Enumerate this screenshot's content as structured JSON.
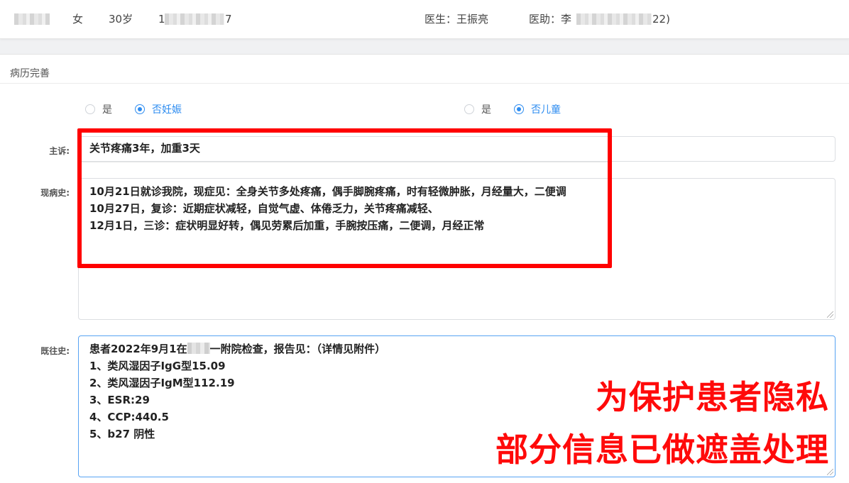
{
  "header": {
    "gender": "女",
    "age": "30岁",
    "phone_prefix": "1",
    "phone_suffix": "7",
    "doctor": "医生：王振亮",
    "assistant_prefix": "医助：李",
    "assistant_suffix": "22)"
  },
  "section": {
    "title": "病历完善"
  },
  "pregnancy": {
    "options": [
      {
        "label": "是",
        "checked": false
      },
      {
        "label": "否妊娠",
        "checked": true
      }
    ]
  },
  "child": {
    "options": [
      {
        "label": "是",
        "checked": false
      },
      {
        "label": "否儿童",
        "checked": true
      }
    ]
  },
  "chief_complaint": {
    "label": "主诉:",
    "value": "关节疼痛3年，加重3天"
  },
  "present_illness": {
    "label": "现病史:",
    "lines": [
      "10月21日就诊我院，现症见：全身关节多处疼痛，偶手脚腕疼痛，时有轻微肿胀，月经量大，二便调",
      "10月27日，复诊：近期症状减轻，自觉气虚、体倦乏力，关节疼痛减轻、",
      "12月1日，三诊：症状明显好转，偶见劳累后加重，手腕按压痛，二便调，月经正常"
    ]
  },
  "past_history": {
    "label": "既往史:",
    "line1_before": "患者2022年9月1在",
    "line1_after": "一附院检查，报告见：（详情见附件）",
    "lines": [
      "1、类风湿因子IgG型15.09",
      "2、类风湿因子IgM型112.19",
      "3、ESR:29",
      "4、CCP:440.5",
      "5、b27 阴性"
    ]
  },
  "privacy_notice": {
    "line1": "为保护患者隐私",
    "line2": "部分信息已做遮盖处理"
  },
  "colors": {
    "accent": "#2d8cf0",
    "highlight": "#ff0000"
  }
}
